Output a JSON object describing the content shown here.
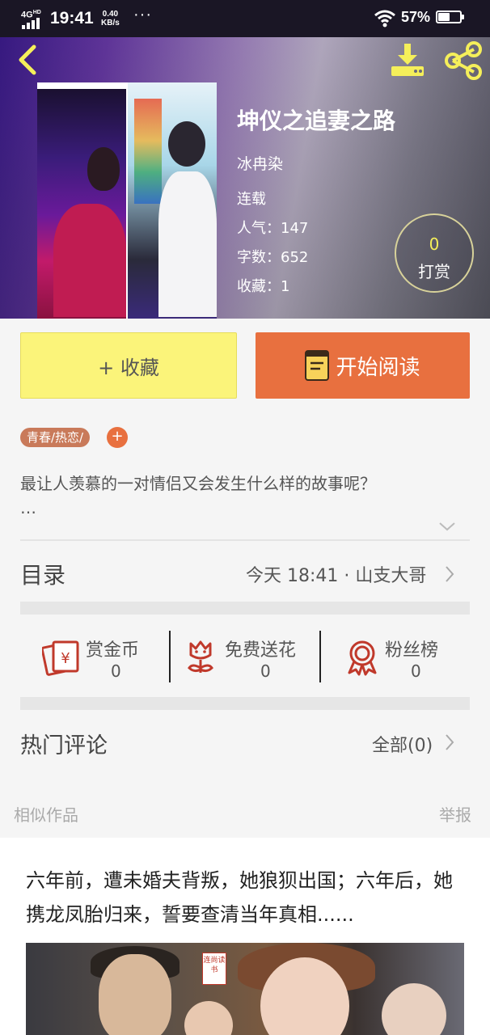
{
  "status_bar": {
    "network": "4G",
    "network_sub": "HD",
    "time": "19:41",
    "speed_value": "0.40",
    "speed_unit": "KB/s",
    "more": "···",
    "battery": "57%"
  },
  "book": {
    "title": "坤仪之追妻之路",
    "author": "冰冉染",
    "status": "连载",
    "popularity": "人气：147",
    "word_count": "字数：652",
    "favorites": "收藏：1",
    "reward_count": "0",
    "reward_label": "打赏"
  },
  "actions": {
    "collect_label": "+ 收藏",
    "read_label": "开始阅读"
  },
  "tags": [
    "青春/热恋/"
  ],
  "tag_add": "+",
  "description": "最让人羡慕的一对情侣又会发生什么样的故事呢？",
  "description_more": "…",
  "toc": {
    "label": "目录",
    "info": "今天 18:41 · 山支大哥"
  },
  "stats": [
    {
      "icon": "red-envelope-icon",
      "label": "赏金币",
      "value": "0"
    },
    {
      "icon": "flower-icon",
      "label": "免费送花",
      "value": "0"
    },
    {
      "icon": "medal-icon",
      "label": "粉丝榜",
      "value": "0"
    }
  ],
  "comments": {
    "label": "热门评论",
    "all": "全部(0)"
  },
  "similar": {
    "label": "相似作品",
    "report": "举报",
    "card_text": "六年前，遭未婚夫背叛，她狼狈出国；六年后，她携龙凤胎归来，誓要查清当年真相......",
    "badge": "连尚读书"
  },
  "colors": {
    "accent_orange": "#e8703f",
    "accent_yellow": "#fbf47a",
    "tag_bg": "#c97a5a",
    "icon_red": "#c0392b"
  }
}
